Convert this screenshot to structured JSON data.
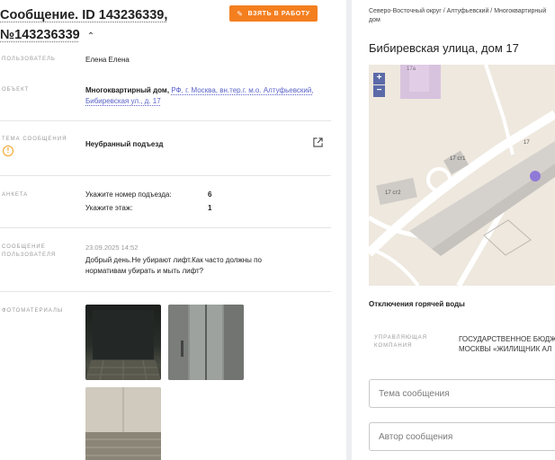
{
  "header": {
    "title_prefix": "Сообщение. ID 143236339,",
    "title_number": "№143236339",
    "chevron": "^",
    "take_button": "ВЗЯТЬ В РАБОТУ"
  },
  "fields": {
    "user_label": "ПОЛЬЗОВАТЕЛЬ",
    "user_value": "Елена Елена",
    "object_label": "ОБЪЕКТ",
    "object_type": "Многоквартирный дом,",
    "object_address": "РФ, г. Москва, вн.тер.г. м.о. Алтуфьевский, Бибиревская ул., д. 17",
    "topic_label": "ТЕМА СООБЩЕНИЯ",
    "topic_value": "Неубранный подъезд",
    "form_label": "АНКЕТА",
    "form_q1": "Укажите номер подъезда:",
    "form_a1": "6",
    "form_q2": "Укажите этаж:",
    "form_a2": "1",
    "msg_label": "СООБЩЕНИЕ ПОЛЬЗОВАТЕЛЯ",
    "msg_date": "23.09.2025 14:52",
    "msg_text": "Добрый день.Не убирают лифт.Как часто должны по нормативам убирать и мыть лифт?",
    "photos_label": "ФОТОМАТЕРИАЛЫ"
  },
  "right": {
    "breadcrumb": "Северо-Восточный округ / Алтуфьевский / Многоквартирный дом",
    "address": "Бибиревская улица, дом 17",
    "map": {
      "zoom_in": "+",
      "zoom_out": "−",
      "labels": [
        "17а",
        "17 ст1",
        "17 ст2",
        "17"
      ]
    },
    "hot_water_title": "Отключения горячей воды",
    "company_label": "УПРАВЛЯЮЩАЯ КОМПАНИЯ",
    "company_value": "ГОСУДАРСТВЕННОЕ БЮДЖ МОСКВЫ «ЖИЛИЩНИК АЛ",
    "topic_placeholder": "Тема сообщения",
    "author_placeholder": "Автор сообщения"
  },
  "colors": {
    "accent": "#f47f1f",
    "link": "#5a63c8",
    "warn": "#f0a020",
    "map_bg": "#eee8de"
  }
}
